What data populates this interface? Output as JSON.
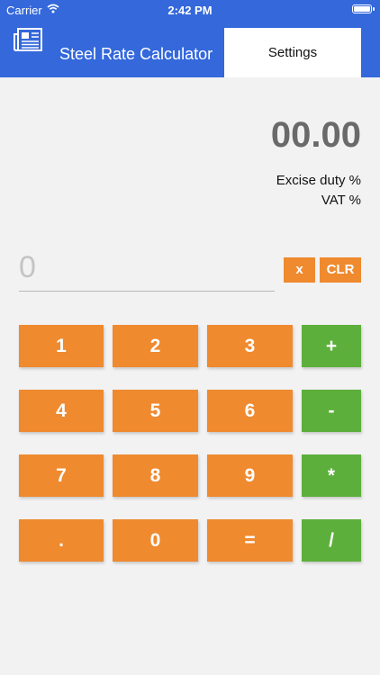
{
  "status_bar": {
    "carrier": "Carrier",
    "time": "2:42 PM"
  },
  "header": {
    "title": "Steel Rate Calculator",
    "settings_label": "Settings"
  },
  "display": {
    "result": "00.00",
    "excise_label": "Excise duty %",
    "vat_label": "VAT %",
    "input_value": "0"
  },
  "actions": {
    "delete_label": "x",
    "clear_label": "CLR"
  },
  "keypad": {
    "k1": "1",
    "k2": "2",
    "k3": "3",
    "plus": "+",
    "k4": "4",
    "k5": "5",
    "k6": "6",
    "minus": "-",
    "k7": "7",
    "k8": "8",
    "k9": "9",
    "multiply": "*",
    "dot": ".",
    "k0": "0",
    "equals": "=",
    "divide": "/"
  },
  "colors": {
    "header": "#3468db",
    "digit_key": "#ef8a2f",
    "operator_key": "#5caf3b",
    "background": "#f2f2f2"
  }
}
